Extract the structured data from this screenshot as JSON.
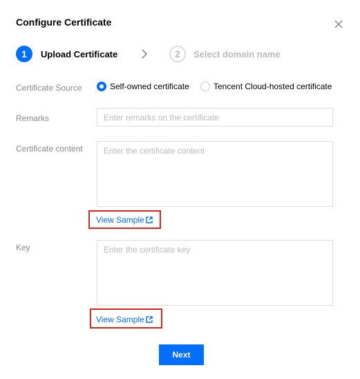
{
  "dialog": {
    "title": "Configure Certificate",
    "close_icon": "close-icon"
  },
  "steps": [
    {
      "number": "1",
      "label": "Upload Certificate",
      "state": "active"
    },
    {
      "number": "2",
      "label": "Select domain name",
      "state": "inactive"
    }
  ],
  "form": {
    "source": {
      "label": "Certificate Source",
      "options": [
        {
          "label": "Self-owned certificate",
          "selected": true
        },
        {
          "label": "Tencent Cloud-hosted certificate",
          "selected": false
        }
      ]
    },
    "remarks": {
      "label": "Remarks",
      "placeholder": "Enter remarks on the certificate",
      "value": ""
    },
    "content": {
      "label": "Certificate content",
      "placeholder": "Enter the certificate content",
      "value": "",
      "sample_link": "View Sample"
    },
    "key": {
      "label": "Key",
      "placeholder": "Enter the certificate key",
      "value": "",
      "sample_link": "View Sample"
    }
  },
  "footer": {
    "next_label": "Next"
  },
  "colors": {
    "primary": "#006eff",
    "highlight_box": "#e0251b",
    "inactive_step": "#bbbbbb"
  }
}
